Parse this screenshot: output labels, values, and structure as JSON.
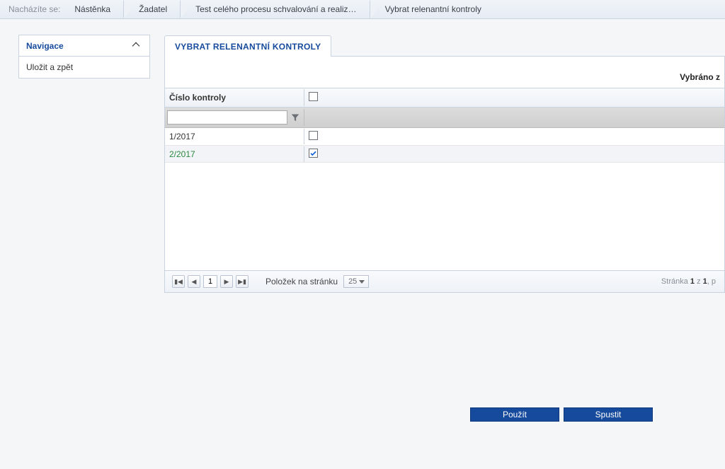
{
  "breadcrumb": {
    "label": "Nacházíte se:",
    "items": [
      "Nástěnka",
      "Žadatel",
      "Test celého procesu schvalování a realiz…",
      "Vybrat relenantní kontroly"
    ]
  },
  "sidebar": {
    "title": "Navigace",
    "items": [
      "Uložit a zpět"
    ]
  },
  "tab": {
    "title": "VYBRAT RELENANTNÍ KONTROLY"
  },
  "selected_label": "Vybráno z",
  "grid": {
    "header_col1": "Číslo kontroly",
    "filter_value": "",
    "rows": [
      {
        "number": "1/2017",
        "checked": false
      },
      {
        "number": "2/2017",
        "checked": true
      }
    ]
  },
  "pager": {
    "page": "1",
    "items_label": "Položek na stránku",
    "page_size": "25",
    "info_prefix": "Stránka ",
    "info_page": "1",
    "info_mid": " z ",
    "info_total": "1",
    "info_suffix": ", p"
  },
  "actions": {
    "apply": "Použít",
    "run": "Spustit"
  }
}
